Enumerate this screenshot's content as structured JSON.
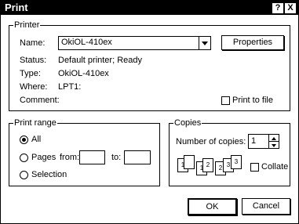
{
  "window": {
    "title": "Print",
    "help_label": "?",
    "close_label": "X"
  },
  "printer": {
    "legend": "Printer",
    "name_label": "Name:",
    "name_value": "OkiOL-410ex",
    "properties_label": "Properties",
    "status_label": "Status:",
    "status_value": "Default printer; Ready",
    "type_label": "Type:",
    "type_value": "OkiOL-410ex",
    "where_label": "Where:",
    "where_value": "LPT1:",
    "comment_label": "Comment:",
    "comment_value": "",
    "print_to_file_label": "Print to file"
  },
  "print_range": {
    "legend": "Print range",
    "all_label": "All",
    "pages_label": "Pages",
    "from_label": "from:",
    "to_label": "to:",
    "from_value": "",
    "to_value": "",
    "selection_label": "Selection"
  },
  "copies": {
    "legend": "Copies",
    "number_label": "Number of copies:",
    "number_value": "1",
    "collate_label": "Collate",
    "page_labels": [
      "1",
      "1",
      "2",
      "2",
      "3",
      "3"
    ]
  },
  "buttons": {
    "ok": "OK",
    "cancel": "Cancel"
  }
}
